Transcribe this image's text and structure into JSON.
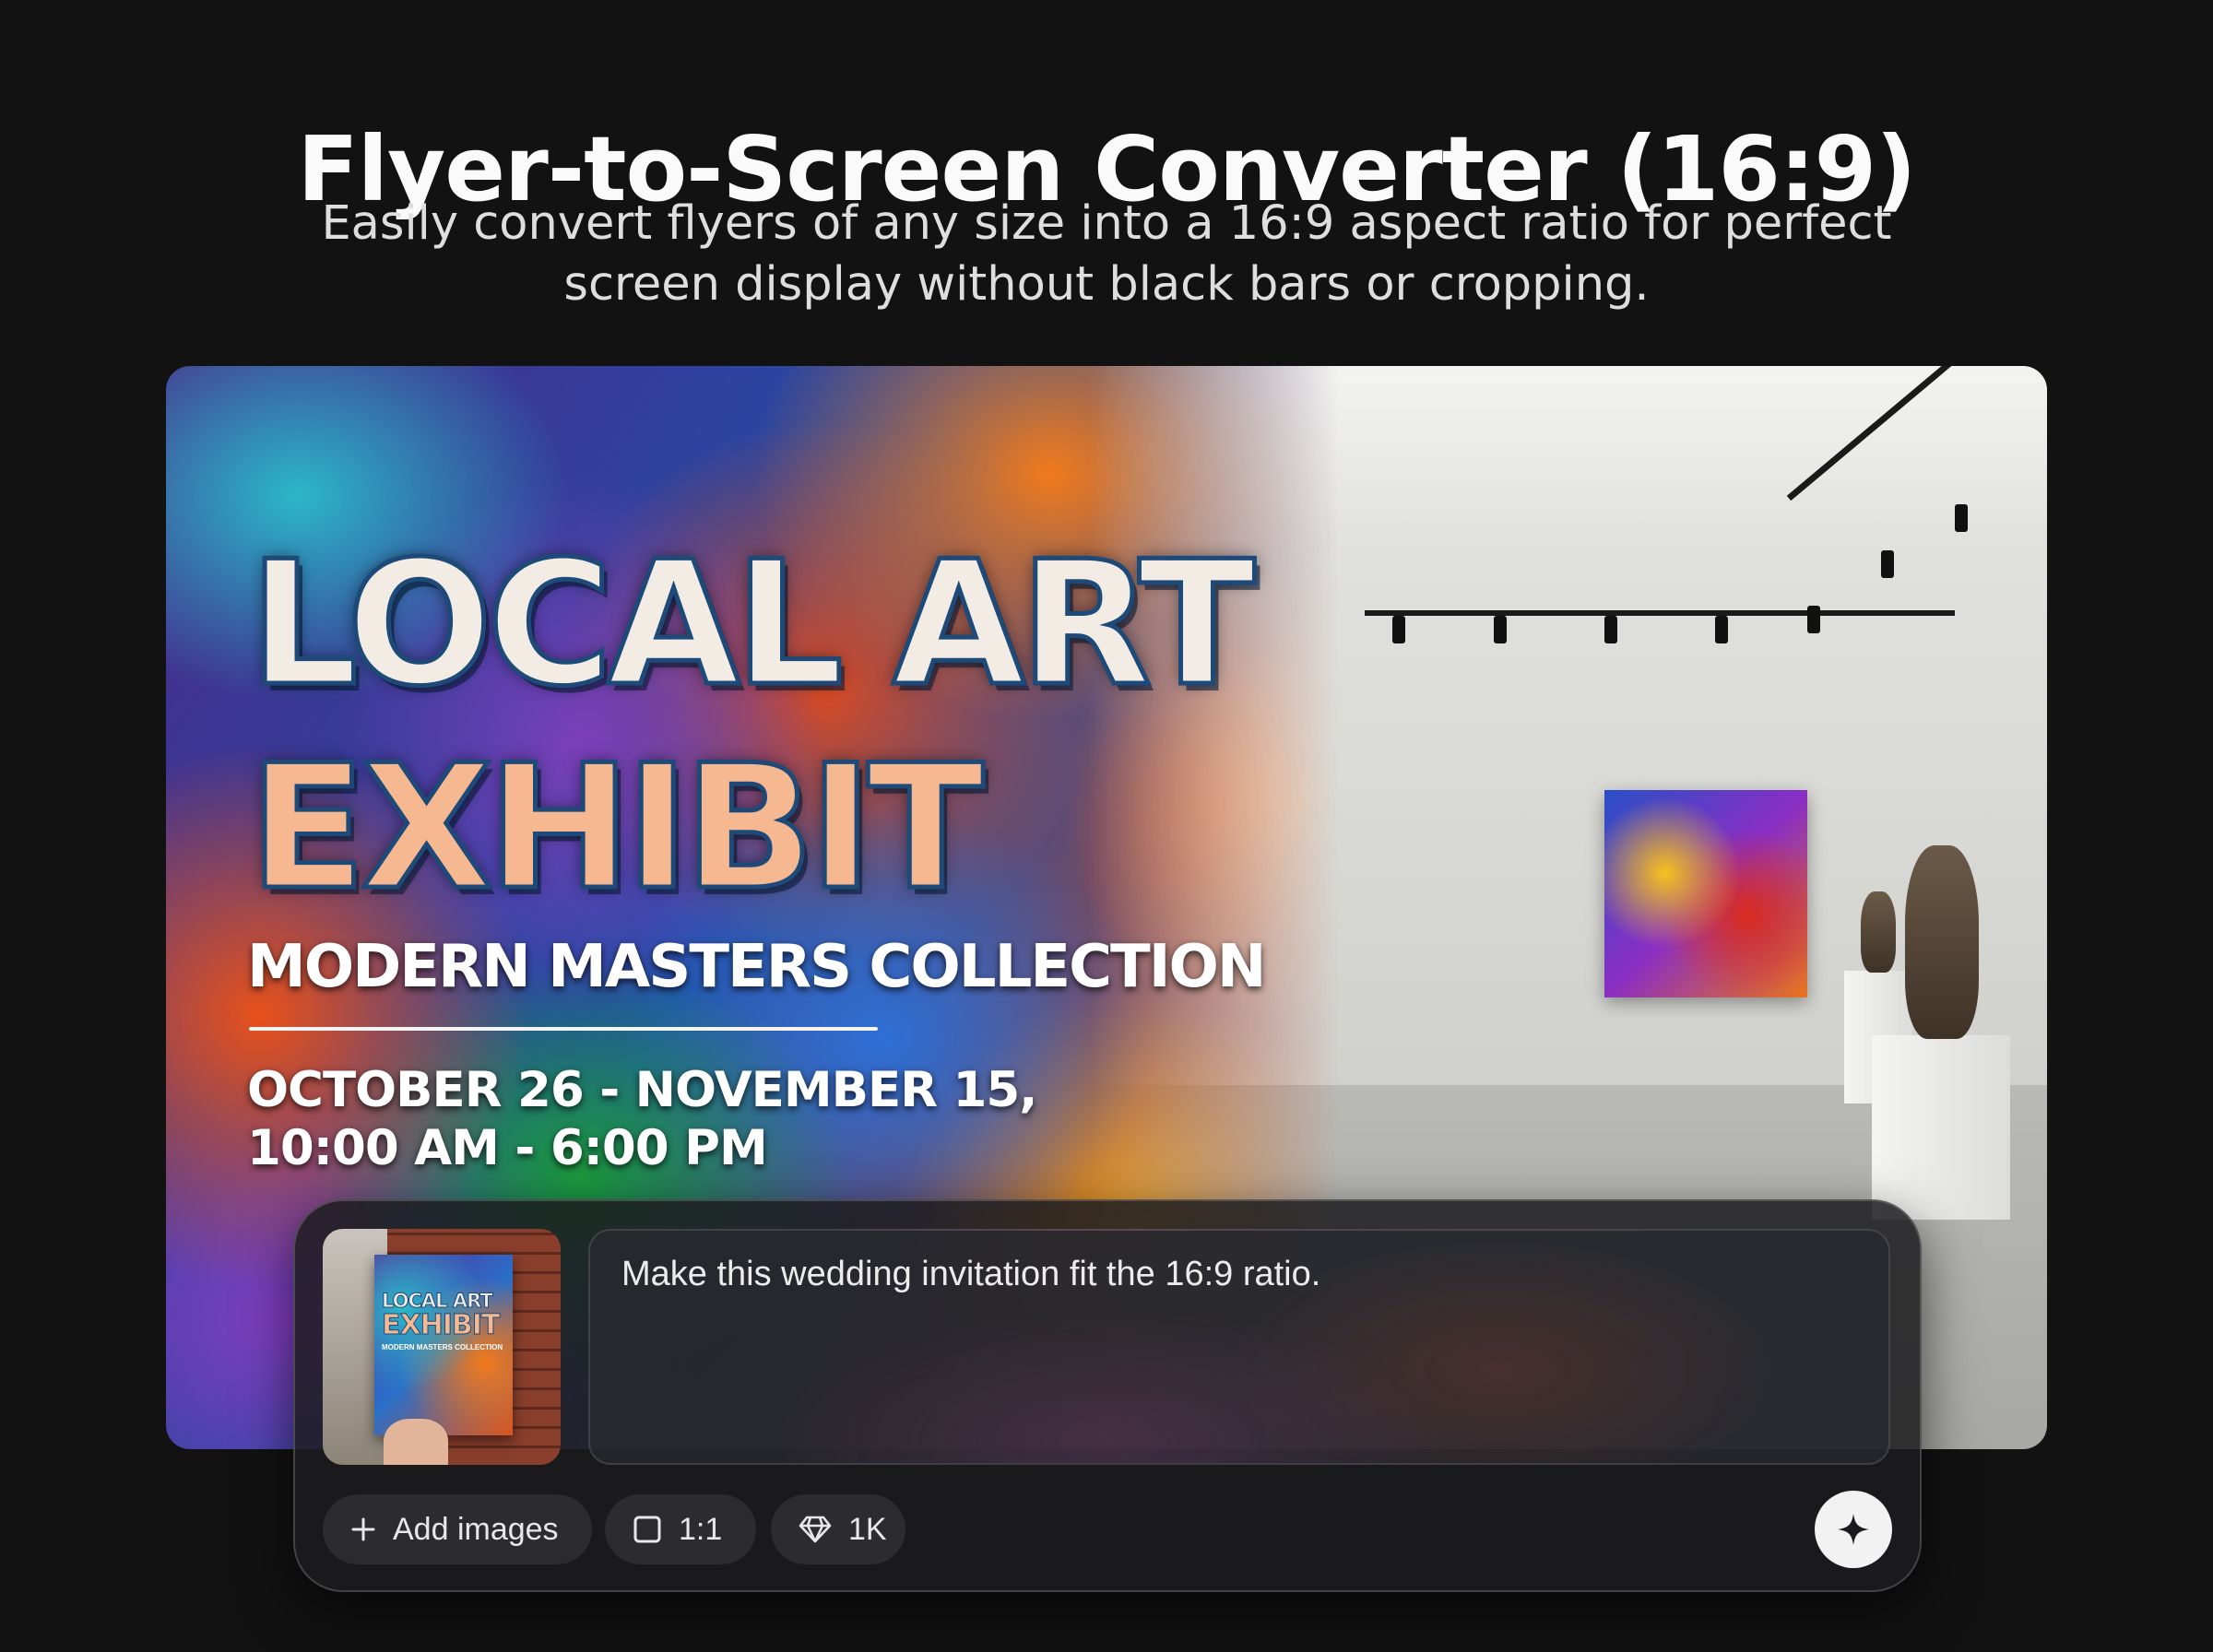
{
  "header": {
    "title": "Flyer-to-Screen Converter (16:9)",
    "subtitle": "Easily convert flyers of any size into a 16:9 aspect ratio for perfect screen display without black bars or cropping."
  },
  "flyer": {
    "title_line1": "LOCAL ART",
    "title_line2": "EXHIBIT",
    "subtitle": "MODERN MASTERS COLLECTION",
    "dates": "OCTOBER 26 - NOVEMBER 15,",
    "hours": "10:00 AM - 6:00 PM"
  },
  "thumbnail": {
    "title_line1": "LOCAL ART",
    "title_line2": "EXHIBIT",
    "subtitle": "MODERN MASTERS COLLECTION"
  },
  "composer": {
    "prompt_text": "Make this wedding invitation fit the 16:9 ratio.",
    "add_images_label": "Add images",
    "ratio_label": "1:1",
    "quality_label": "1K",
    "icons": {
      "add": "plus-icon",
      "ratio": "square-icon",
      "quality": "diamond-icon",
      "send": "sparkle-icon"
    }
  },
  "colors": {
    "background": "#121212",
    "title_text": "#fafafa",
    "subtitle_text": "#dedede",
    "composer_bg": "#1c1c1e",
    "pill_bg": "#2c2c2e",
    "send_button_bg": "#f2f2f2",
    "flyer_title_fill": "#f2ece4",
    "flyer_title_gradient_end": "#f6b891",
    "flyer_title_outline": "#1d4a78"
  }
}
